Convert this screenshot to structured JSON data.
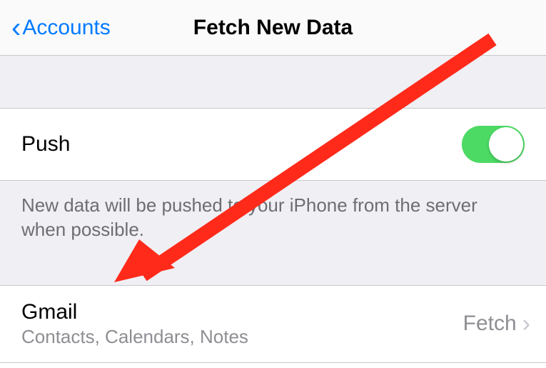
{
  "nav": {
    "back_label": "Accounts",
    "title": "Fetch New Data"
  },
  "push": {
    "label": "Push",
    "enabled": true,
    "description": "New data will be pushed to your iPhone from the server when possible."
  },
  "accounts": [
    {
      "name": "Gmail",
      "detail": "Contacts, Calendars, Notes",
      "mode": "Fetch"
    }
  ],
  "colors": {
    "accent": "#007aff",
    "toggle_on": "#4cd964",
    "annotation": "#ff2a1a"
  }
}
